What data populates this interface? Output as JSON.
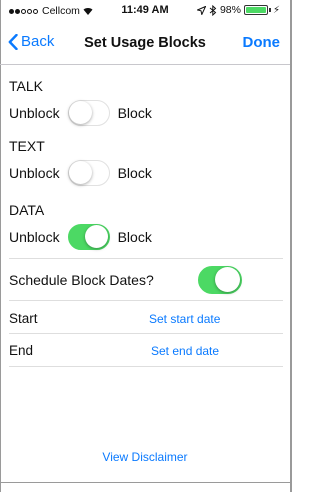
{
  "status_bar": {
    "carrier": "Cellcom",
    "time": "11:49 AM",
    "battery": "98%",
    "battery_level": 0.98,
    "icons": [
      "signal-dots-icon",
      "wifi-icon",
      "location-arrow-icon",
      "bluetooth-icon",
      "battery-icon",
      "charging-bolt-icon"
    ]
  },
  "nav": {
    "back_label": "Back",
    "title": "Set Usage Blocks",
    "done_label": "Done"
  },
  "sections": [
    {
      "label": "TALK",
      "off_label": "Unblock",
      "on_label": "Block",
      "blocked": false
    },
    {
      "label": "TEXT",
      "off_label": "Unblock",
      "on_label": "Block",
      "blocked": false
    },
    {
      "label": "DATA",
      "off_label": "Unblock",
      "on_label": "Block",
      "blocked": true
    }
  ],
  "schedule": {
    "label": "Schedule Block Dates?",
    "enabled": true,
    "start_label": "Start",
    "start_link": "Set start date",
    "end_label": "End",
    "end_link": "Set end date"
  },
  "footer": {
    "disclaimer_link": "View Disclaimer"
  },
  "colors": {
    "accent": "#0a7aff",
    "toggle_on": "#4cd964",
    "divider": "#dedede"
  }
}
